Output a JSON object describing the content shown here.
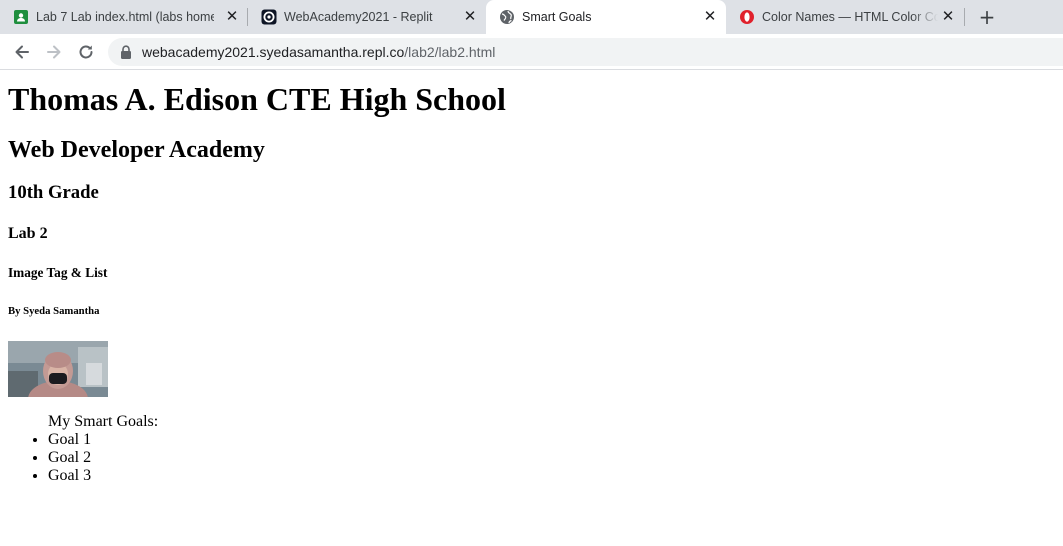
{
  "tabs": [
    {
      "title": "Lab 7 Lab index.html (labs home",
      "icon": "classroom-icon",
      "active": false
    },
    {
      "title": "WebAcademy2021 - Replit",
      "icon": "replit-icon",
      "active": false
    },
    {
      "title": "Smart Goals",
      "icon": "globe-icon",
      "active": true
    },
    {
      "title": "Color Names — HTML Color Cod",
      "icon": "opera-icon",
      "active": false
    }
  ],
  "address": {
    "host": "webacademy2021.syedasamantha.repl.co",
    "path": "/lab2/lab2.html"
  },
  "page": {
    "h1": "Thomas A. Edison CTE High School",
    "h2": "Web Developer Academy",
    "h3": "10th Grade",
    "h4": "Lab 2",
    "h5": "Image Tag & List",
    "h6": "By Syeda Samantha",
    "list_caption": "My Smart Goals:",
    "goals": [
      "Goal 1",
      "Goal 2",
      "Goal 3"
    ]
  },
  "colors": {
    "tabstrip_bg": "#dee1e6",
    "omnibox_bg": "#f1f3f4",
    "classroom_green": "#1e8e3e",
    "opera_red": "#e0212c"
  }
}
